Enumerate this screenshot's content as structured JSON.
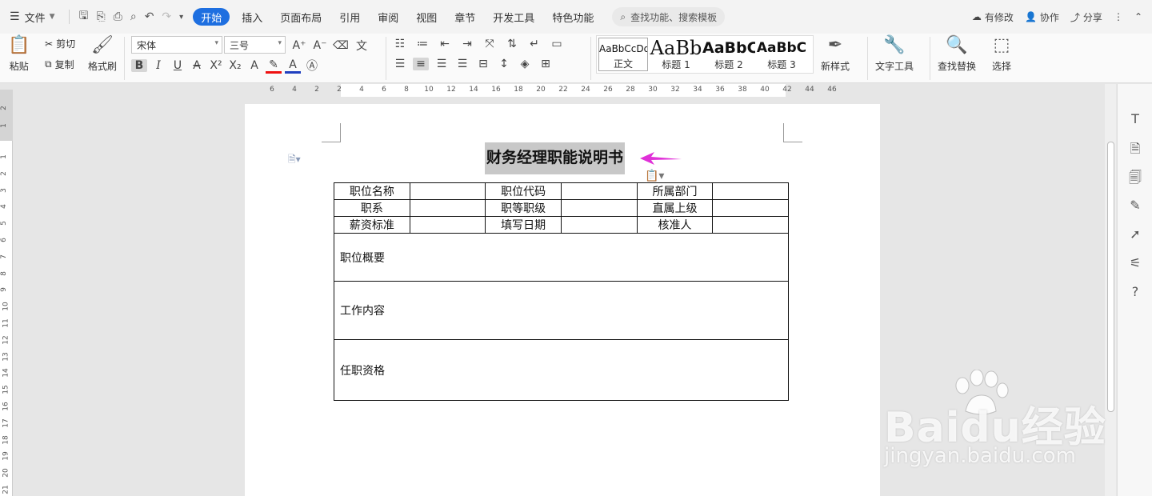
{
  "menubar": {
    "file_label": "文件",
    "tabs": [
      {
        "label": "开始",
        "active": true
      },
      {
        "label": "插入",
        "active": false
      },
      {
        "label": "页面布局",
        "active": false
      },
      {
        "label": "引用",
        "active": false
      },
      {
        "label": "审阅",
        "active": false
      },
      {
        "label": "视图",
        "active": false
      },
      {
        "label": "章节",
        "active": false
      },
      {
        "label": "开发工具",
        "active": false
      },
      {
        "label": "特色功能",
        "active": false
      }
    ],
    "search_placeholder": "查找功能、搜索模板",
    "right": {
      "modified": "有修改",
      "collab": "协作",
      "share": "分享"
    }
  },
  "ribbon": {
    "clipboard": {
      "paste": "粘贴",
      "cut": "剪切",
      "copy": "复制",
      "format_painter": "格式刷"
    },
    "font_name": "宋体",
    "font_size": "三号",
    "styles": [
      {
        "sample": "AaBbCcDd",
        "name": "正文"
      },
      {
        "sample": "AaBb",
        "name": "标题 1"
      },
      {
        "sample": "AaBbC",
        "name": "标题 2"
      },
      {
        "sample": "AaBbC",
        "name": "标题 3"
      }
    ],
    "new_style": "新样式",
    "text_tools": "文字工具",
    "find_replace": "查找替换",
    "select": "选择"
  },
  "ruler": {
    "h_ticks": [
      "6",
      "4",
      "2",
      "2",
      "4",
      "6",
      "8",
      "10",
      "12",
      "14",
      "16",
      "18",
      "20",
      "22",
      "24",
      "26",
      "28",
      "30",
      "32",
      "34",
      "36",
      "38",
      "40",
      "42",
      "44",
      "46"
    ],
    "v_ticks_top": [
      "2",
      "1"
    ],
    "v_ticks": [
      "1",
      "2",
      "3",
      "4",
      "5",
      "6",
      "7",
      "8",
      "9",
      "10",
      "11",
      "12",
      "13",
      "14",
      "15",
      "16",
      "17",
      "18",
      "19",
      "20",
      "21"
    ]
  },
  "document": {
    "title": "财务经理职能说明书",
    "table": {
      "rows": [
        [
          "职位名称",
          "",
          "职位代码",
          "",
          "所属部门",
          ""
        ],
        [
          "职系",
          "",
          "职等职级",
          "",
          "直属上级",
          ""
        ],
        [
          "薪资标准",
          "",
          "填写日期",
          "",
          "核准人",
          ""
        ]
      ],
      "sections": [
        "职位概要",
        "工作内容",
        "任职资格"
      ]
    }
  },
  "watermark": {
    "brand": "Baidu经验",
    "url": "jingyan.baidu.com"
  },
  "colors": {
    "accent": "#1e6fe0",
    "arrow": "#e030d8",
    "title_highlight": "#c8c8c8"
  }
}
